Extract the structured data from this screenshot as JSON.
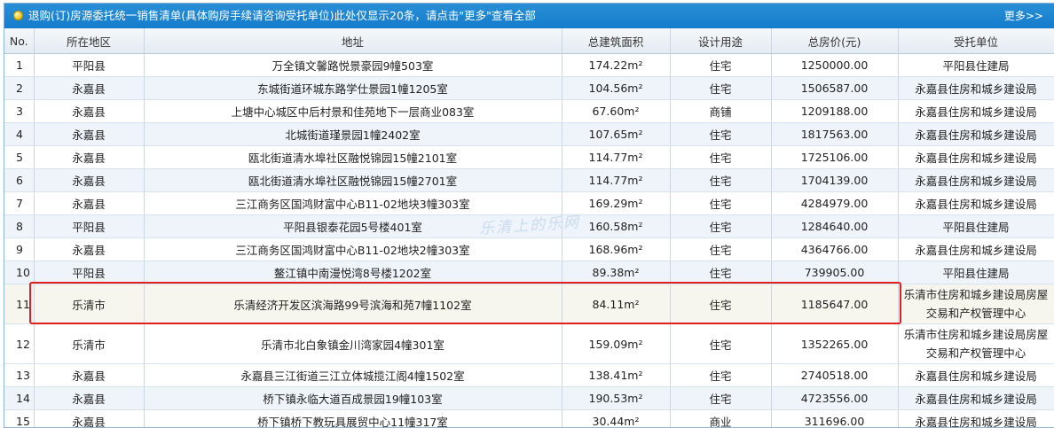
{
  "notice": {
    "text_before": "退购(订)房源委托统一销售清单(具体购房手续请咨询受托单位)此处仅显示20条，请点击",
    "more_link": "\"更多\"",
    "text_after": "查看全部",
    "more_top": "更多>>"
  },
  "watermark": "乐清上的乐网",
  "columns": [
    "No.",
    "所在地区",
    "地址",
    "总建筑面积",
    "设计用途",
    "总房价(元)",
    "受托单位"
  ],
  "rows": [
    {
      "no": "1",
      "region": "平阳县",
      "address": "万全镇文馨路悦景豪园9幢503室",
      "area": "174.22m²",
      "usage": "住宅",
      "price": "1250000.00",
      "agency": "平阳县住建局"
    },
    {
      "no": "2",
      "region": "永嘉县",
      "address": "东城街道环城东路学仕景园1幢1205室",
      "area": "104.56m²",
      "usage": "住宅",
      "price": "1506587.00",
      "agency": "永嘉县住房和城乡建设局"
    },
    {
      "no": "3",
      "region": "永嘉县",
      "address": "上塘中心城区中后村景和佳苑地下一层商业083室",
      "area": "67.60m²",
      "usage": "商铺",
      "price": "1209188.00",
      "agency": "永嘉县住房和城乡建设局"
    },
    {
      "no": "4",
      "region": "永嘉县",
      "address": "北城街道瑾景园1幢2402室",
      "area": "107.65m²",
      "usage": "住宅",
      "price": "1817563.00",
      "agency": "永嘉县住房和城乡建设局"
    },
    {
      "no": "5",
      "region": "永嘉县",
      "address": "瓯北街道清水埠社区融悦锦园15幢2101室",
      "area": "114.77m²",
      "usage": "住宅",
      "price": "1725106.00",
      "agency": "永嘉县住房和城乡建设局"
    },
    {
      "no": "6",
      "region": "永嘉县",
      "address": "瓯北街道清水埠社区融悦锦园15幢2701室",
      "area": "114.77m²",
      "usage": "住宅",
      "price": "1704139.00",
      "agency": "永嘉县住房和城乡建设局"
    },
    {
      "no": "7",
      "region": "永嘉县",
      "address": "三江商务区国鸿财富中心B11-02地块3幢303室",
      "area": "169.29m²",
      "usage": "住宅",
      "price": "4284979.00",
      "agency": "永嘉县住房和城乡建设局"
    },
    {
      "no": "8",
      "region": "平阳县",
      "address": "平阳县银泰花园5号楼401室",
      "area": "160.58m²",
      "usage": "住宅",
      "price": "1284640.00",
      "agency": "平阳县住建局"
    },
    {
      "no": "9",
      "region": "永嘉县",
      "address": "三江商务区国鸿财富中心B11-02地块2幢303室",
      "area": "168.96m²",
      "usage": "住宅",
      "price": "4364766.00",
      "agency": "永嘉县住房和城乡建设局"
    },
    {
      "no": "10",
      "region": "平阳县",
      "address": "鳌江镇中南漫悦湾8号楼1202室",
      "area": "89.38m²",
      "usage": "住宅",
      "price": "739905.00",
      "agency": "平阳县住建局"
    },
    {
      "no": "11",
      "region": "乐清市",
      "address": "乐清经济开发区滨海路99号滨海和苑7幢1102室",
      "area": "84.11m²",
      "usage": "住宅",
      "price": "1185647.00",
      "agency": "乐清市住房和城乡建设局房屋交易和产权管理中心"
    },
    {
      "no": "12",
      "region": "乐清市",
      "address": "乐清市北白象镇金川湾家园4幢301室",
      "area": "159.09m²",
      "usage": "住宅",
      "price": "1352265.00",
      "agency": "乐清市住房和城乡建设局房屋交易和产权管理中心"
    },
    {
      "no": "13",
      "region": "永嘉县",
      "address": "永嘉县三江街道三江立体城揽江阁4幢1502室",
      "area": "138.41m²",
      "usage": "住宅",
      "price": "2740518.00",
      "agency": "永嘉县住房和城乡建设局"
    },
    {
      "no": "14",
      "region": "永嘉县",
      "address": "桥下镇永临大道百成景园19幢103室",
      "area": "190.53m²",
      "usage": "住宅",
      "price": "4723556.00",
      "agency": "永嘉县住房和城乡建设局"
    },
    {
      "no": "15",
      "region": "永嘉县",
      "address": "桥下镇桥下教玩具展贸中心11幢317室",
      "area": "30.44m²",
      "usage": "商业",
      "price": "311696.00",
      "agency": "永嘉县住房和城乡建设局"
    }
  ],
  "colors": {
    "header_bar": "#1d86d1",
    "even_row": "#eef4fa",
    "highlight": "#e02020"
  }
}
